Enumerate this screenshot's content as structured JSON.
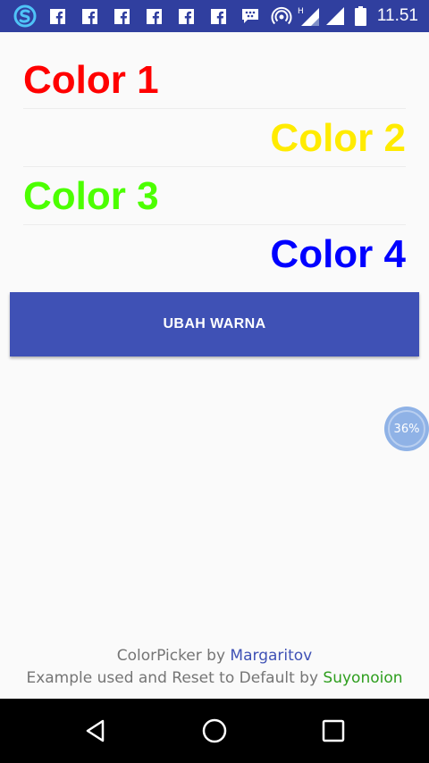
{
  "status_bar": {
    "time": "11.51",
    "background": "#303f9f",
    "icons": [
      "sync-app-icon",
      "facebook-icon",
      "facebook-icon",
      "facebook-icon",
      "facebook-icon",
      "facebook-icon",
      "facebook-icon",
      "bbm-chat-icon",
      "hotspot-icon",
      "signal-icon",
      "signal-icon",
      "battery-icon"
    ]
  },
  "colors": [
    {
      "label": "Color 1",
      "color": "#ff0000",
      "align": "left"
    },
    {
      "label": "Color 2",
      "color": "#ffeb00",
      "align": "right"
    },
    {
      "label": "Color 3",
      "color": "#4cff00",
      "align": "left"
    },
    {
      "label": "Color 4",
      "color": "#0000ff",
      "align": "right"
    }
  ],
  "button": {
    "label": "UBAH WARNA",
    "color": "#3f51b5"
  },
  "float_widget": {
    "label": "36%",
    "progress": 36
  },
  "credits": {
    "line1_prefix": "ColorPicker by ",
    "line1_name": "Margaritov",
    "line2_prefix": "Example used and Reset to Default by ",
    "line2_name": "Suyonoion"
  },
  "nav_bar": {
    "buttons": [
      "back-icon",
      "home-icon",
      "recents-icon"
    ]
  }
}
